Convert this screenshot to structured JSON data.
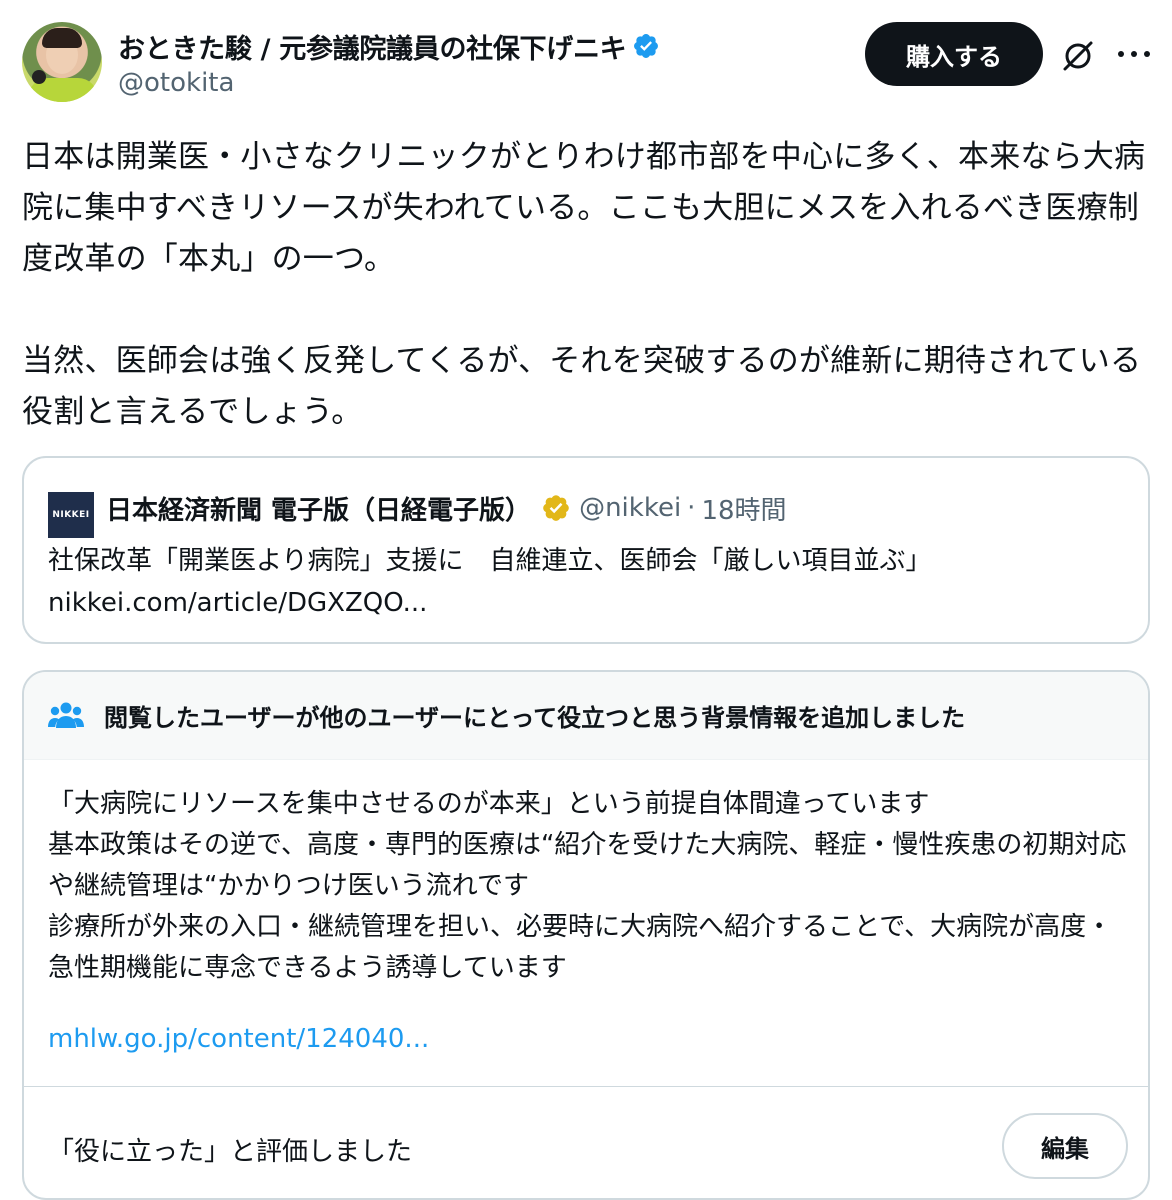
{
  "author": {
    "display_name": "おときた駿 / 元参議院議員の社保下げニキ",
    "handle": "@otokita",
    "verified": true,
    "verified_color": "#1d9bf0"
  },
  "actions": {
    "buy_label": "購入する",
    "grok_icon": "grok-icon",
    "more_icon": "more-icon"
  },
  "tweet": {
    "text": "日本は開業医・小さなクリニックがとりわけ都市部を中心に多く、本来なら大病院に集中すべきリソースが失われている。ここも大胆にメスを入れるべき医療制度改革の「本丸」の一つ。\n\n当然、医師会は強く反発してくるが、それを突破するのが維新に期待されている役割と言えるでしょう。"
  },
  "quote": {
    "logo_text": "NIKKEI",
    "name": "日本経済新聞 電子版（日経電子版）",
    "verified_color": "#e2b719",
    "handle": "@nikkei",
    "separator": "·",
    "time": "18時間",
    "text": "社保改革「開業医より病院」支援に　自維連立、医師会「厳しい項目並ぶ」\nnikkei.com/article/DGXZQO..."
  },
  "community_note": {
    "title": "閲覧したユーザーが他のユーザーにとって役立つと思う背景情報を追加しました",
    "body": "「大病院にリソースを集中させるのが本来」という前提自体間違っています\n基本政策はその逆で、高度・専門的医療は“紹介を受けた大病院、軽症・慢性疾患の初期対応や継続管理は“かかりつけ医いう流れです\n診療所が外来の入口・継続管理を担い、必要時に大病院へ紹介することで、大病院が高度・急性期機能に専念できるよう誘導しています",
    "link": "mhlw.go.jp/content/124040...",
    "link_color": "#1d9bf0",
    "rated_text": "「役に立った」と評価しました",
    "edit_label": "編集"
  }
}
